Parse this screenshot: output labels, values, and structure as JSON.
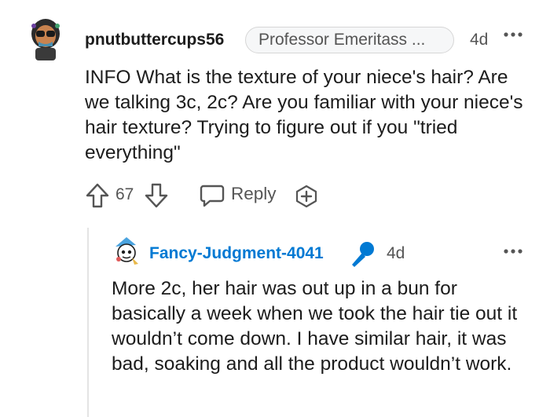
{
  "comment": {
    "author": "pnutbuttercups56",
    "flair": "Professor Emeritass ...",
    "time": "4d",
    "body": "INFO What is the texture of your niece's hair? Are we talking 3c, 2c? Are you familiar with your niece's hair texture? Trying to figure out if you \"tried everything\"",
    "score": "67",
    "reply_label": "Reply",
    "icons": [
      "user-avatar",
      "more-options-icon",
      "upvote-icon",
      "downvote-icon",
      "reply-icon",
      "award-icon"
    ]
  },
  "reply": {
    "author": "Fancy-Judgment-4041",
    "time": "4d",
    "body": "More 2c, her hair was out up in a bun for basically a week when we took the hair tie out it wouldn’t come down. I have similar hair, it was bad, soaking and all the product wouldn’t work.",
    "icons": [
      "user-avatar",
      "microphone-icon",
      "more-options-icon"
    ]
  },
  "colors": {
    "text": "#1c1c1c",
    "meta": "#555555",
    "link_blue": "#0079d3",
    "flair_bg": "#f6f7f8",
    "thread_line": "#e4e4e4"
  }
}
